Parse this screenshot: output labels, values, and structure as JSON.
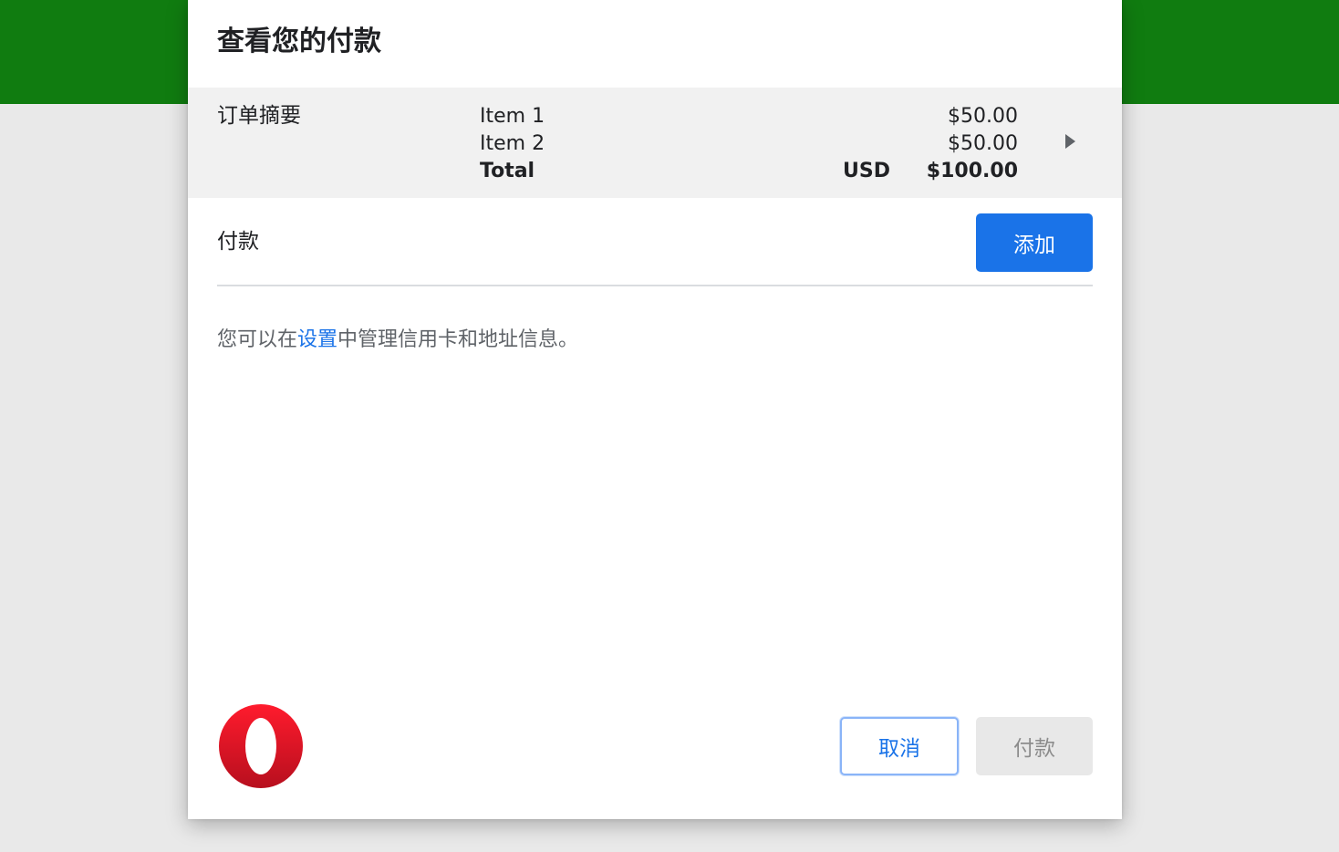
{
  "colors": {
    "header_band": "#107c10",
    "accent_blue": "#1a73e8",
    "link_blue": "#1a73e8",
    "opera_red": "#e8121f"
  },
  "dialog": {
    "title": "查看您的付款"
  },
  "order_summary": {
    "label": "订单摘要",
    "items": [
      {
        "name": "Item 1",
        "amount": "$50.00"
      },
      {
        "name": "Item 2",
        "amount": "$50.00"
      }
    ],
    "total": {
      "label": "Total",
      "currency": "USD",
      "amount": "$100.00"
    },
    "expand_icon": "triangle-right-icon"
  },
  "payment": {
    "label": "付款",
    "add_button": "添加"
  },
  "info": {
    "before": "您可以在",
    "link": "设置",
    "after": "中管理信用卡和地址信息。"
  },
  "footer": {
    "logo_icon": "opera-logo-icon",
    "cancel_button": "取消",
    "pay_button": "付款"
  }
}
